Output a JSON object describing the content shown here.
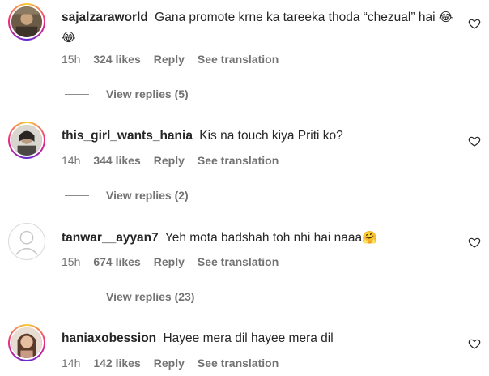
{
  "comments": [
    {
      "username": "sajalzaraworld",
      "text": "Gana promote krne ka tareeka thoda “chezual” hai",
      "emoji": "😂😂",
      "time": "15h",
      "likes": "324 likes",
      "reply": "Reply",
      "translate": "See translation",
      "view_replies": "View replies (5)",
      "avatar_icon": "profile-photo"
    },
    {
      "username": "this_girl_wants_hania",
      "text": "Kis na touch kiya Priti ko?",
      "emoji": "",
      "time": "14h",
      "likes": "344 likes",
      "reply": "Reply",
      "translate": "See translation",
      "view_replies": "View replies (2)",
      "avatar_icon": "profile-photo"
    },
    {
      "username": "tanwar__ayyan7",
      "text": "Yeh mota badshah toh nhi hai naaa",
      "emoji": "🤗",
      "time": "15h",
      "likes": "674 likes",
      "reply": "Reply",
      "translate": "See translation",
      "view_replies": "View replies (23)",
      "avatar_icon": "default-user"
    },
    {
      "username": "haniaxobession",
      "text": "Hayee mera dil hayee mera dil",
      "emoji": "",
      "time": "14h",
      "likes": "142 likes",
      "reply": "Reply",
      "translate": "See translation",
      "avatar_icon": "profile-photo"
    }
  ],
  "colors": {
    "text": "#262626",
    "secondary": "#737373",
    "ring_start": "#f9ce34",
    "ring_mid": "#ee2a7b",
    "ring_end": "#6228d7"
  },
  "icons": {
    "like": "heart-outline-icon"
  }
}
